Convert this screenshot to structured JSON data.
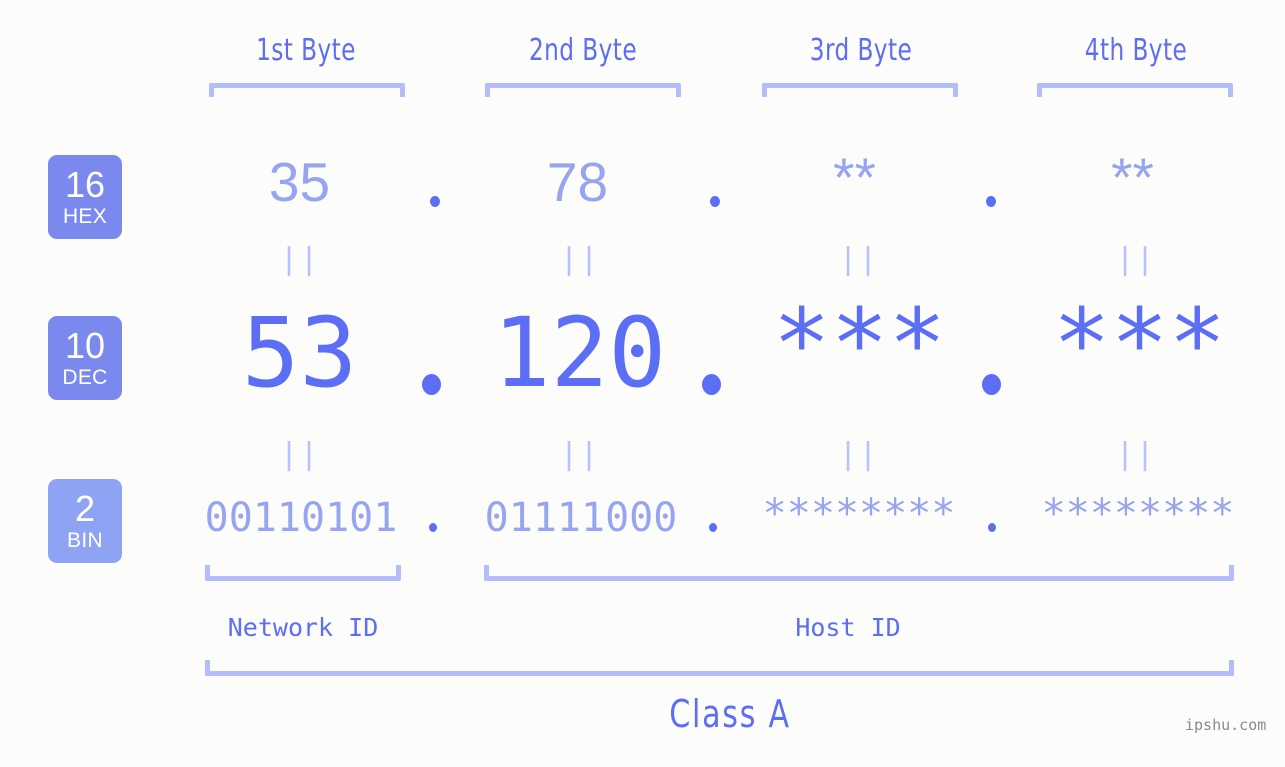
{
  "background_color": "#fcfdfa",
  "accent_color": "#5b6ef5",
  "accent_light_color": "#97a4f0",
  "bracket_color": "#b3bdfb",
  "header": {
    "bytes": [
      {
        "label": "1st Byte"
      },
      {
        "label": "2nd Byte"
      },
      {
        "label": "3rd Byte"
      },
      {
        "label": "4th Byte"
      }
    ]
  },
  "rows": [
    {
      "base_number": "16",
      "base_abbr": "HEX",
      "badge_color": "#7b89ef",
      "values": [
        "35",
        "78",
        "**",
        "**"
      ],
      "separator": "."
    },
    {
      "base_number": "10",
      "base_abbr": "DEC",
      "badge_color": "#7b89ef",
      "values": [
        "53",
        "120",
        "***",
        "***"
      ],
      "separator": "."
    },
    {
      "base_number": "2",
      "base_abbr": "BIN",
      "badge_color": "#8fa3f4",
      "values": [
        "00110101",
        "01111000",
        "********",
        "********"
      ],
      "separator": "."
    }
  ],
  "equality_marks": [
    "||",
    "||",
    "||",
    "||",
    "||",
    "||",
    "||",
    "||"
  ],
  "id_sections": [
    {
      "label": "Network ID"
    },
    {
      "label": "Host ID"
    }
  ],
  "class_label": "Class A",
  "watermark": "ipshu.com"
}
